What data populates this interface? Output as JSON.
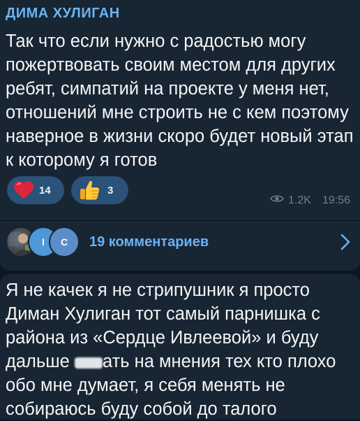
{
  "post": {
    "author": "ДИМА ХУЛИГАН",
    "text": "Так что если нужно с радостью могу пожертвовать своим местом для других ребят, симпатий на проекте у меня нет, отношений мне строить не с кем поэтому наверное в жизни скоро будет новый этап к которому я готов",
    "reactions": [
      {
        "icon": "red-heart-icon",
        "count": "14"
      },
      {
        "icon": "thumbs-up-icon",
        "count": "3"
      }
    ],
    "views": "1.2K",
    "time": "19:56"
  },
  "comments": {
    "avatar_letters": [
      "I",
      "C"
    ],
    "label": "19 комментариев"
  },
  "next_post": {
    "text_before": "Я не качек я не стрипушник я просто Диман Хулиган тот самый парнишка с района из «Сердце Ивлеевой» и буду дальше ",
    "text_after": "ать на мнения тех кто плохо обо мне думает, я себя менять не собираюсь буду собой до талого"
  },
  "colors": {
    "background": "#0e1621",
    "bubble": "#182533",
    "accent": "#6ab3f3",
    "reaction_pill": "#2b5278",
    "meta": "#6d7f8f"
  }
}
